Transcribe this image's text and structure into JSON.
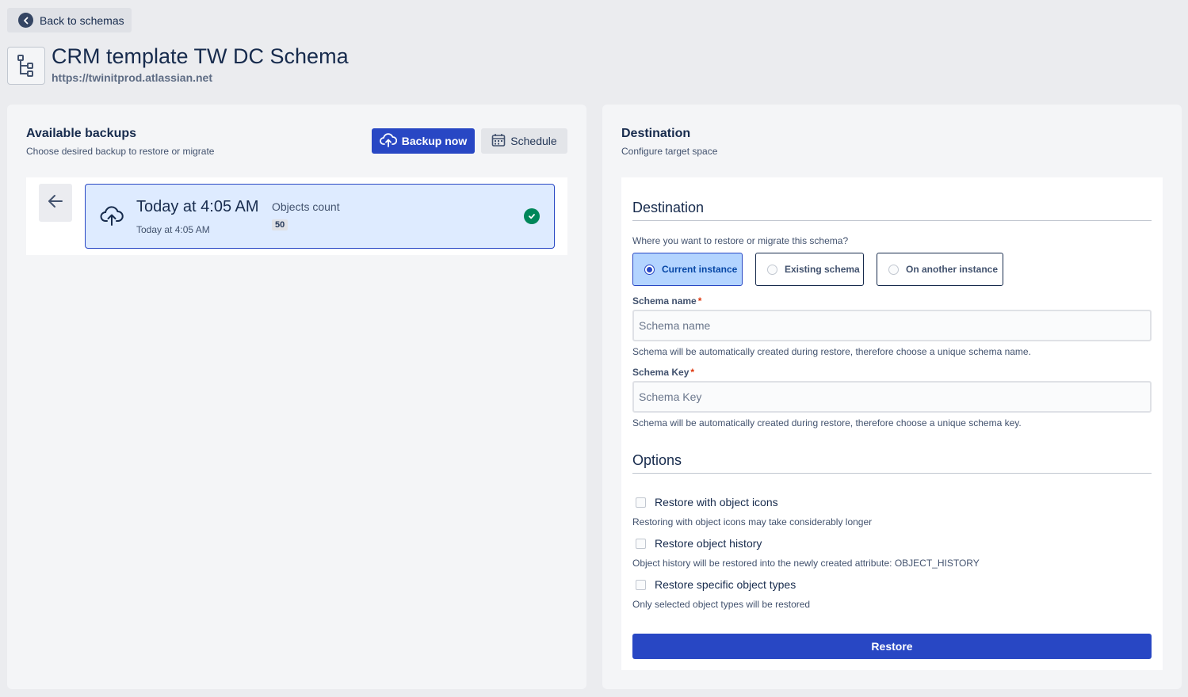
{
  "header": {
    "back_label": "Back to schemas",
    "title": "CRM template TW DC Schema",
    "url": "https://twinitprod.atlassian.net"
  },
  "backups": {
    "title": "Available backups",
    "subtitle": "Choose desired backup to restore or migrate",
    "backup_now_label": "Backup now",
    "schedule_label": "Schedule",
    "items": [
      {
        "title": "Today at 4:05 AM",
        "subtitle": "Today at 4:05 AM",
        "objects_label": "Objects count",
        "objects_count": "50",
        "status": "success"
      }
    ]
  },
  "destination": {
    "title": "Destination",
    "subtitle": "Configure target space",
    "section_title": "Destination",
    "question": "Where you want to restore or migrate this schema?",
    "options": [
      {
        "label": "Current instance",
        "selected": true
      },
      {
        "label": "Existing schema",
        "selected": false
      },
      {
        "label": "On another instance",
        "selected": false
      }
    ],
    "schema_name": {
      "label": "Schema name",
      "required_mark": "*",
      "value": "",
      "placeholder": "Schema name",
      "help": "Schema will be automatically created during restore, therefore choose a unique schema name."
    },
    "schema_key": {
      "label": "Schema Key",
      "required_mark": "*",
      "value": "",
      "placeholder": "Schema Key",
      "help": "Schema will be automatically created during restore, therefore choose a unique schema key."
    },
    "options_title": "Options",
    "checkboxes": [
      {
        "label": "Restore with object icons",
        "checked": false,
        "help": "Restoring with object icons may take considerably longer"
      },
      {
        "label": "Restore object history",
        "checked": false,
        "help": "Object history will be restored into the newly created attribute: OBJECT_HISTORY"
      },
      {
        "label": "Restore specific object types",
        "checked": false,
        "help": "Only selected object types will be restored"
      }
    ],
    "restore_label": "Restore"
  },
  "colors": {
    "primary": "#2847c4",
    "success": "#00875a",
    "selected_bg": "#b3d4ff",
    "card_bg": "#deebff"
  },
  "icons": {
    "back": "chevron-left-icon",
    "schema": "hierarchy-icon",
    "backup_now": "cloud-upload-icon",
    "schedule": "calendar-icon",
    "list_back": "arrow-left-icon",
    "backup_item": "cloud-upload-icon",
    "status": "check-circle-icon"
  }
}
